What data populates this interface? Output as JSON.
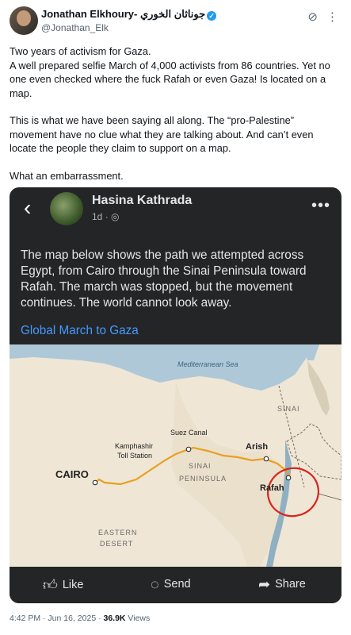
{
  "author": {
    "name": "Jonathan Elkhoury- جوناثان الخوري",
    "handle": "@Jonathan_Elk"
  },
  "tweet": {
    "line1": "Two years of activism for Gaza.",
    "line2": "A well prepared selfie March of 4,000 activists from 86 countries. Yet no one even checked where the fuck Rafah or even Gaza! Is located on a map.",
    "line3": "This is what we have been saying all along. The “pro-Palestine” movement have no clue what they are talking about. And can’t even locate the people they claim to support on a map.",
    "line4": "What an embarrassment."
  },
  "embedded_post": {
    "author": "Hasina Kathrada",
    "age": "1d",
    "text": "The map below shows the path we attempted across Egypt, from Cairo through the Sinai Peninsula toward Rafah. The march was stopped, but the movement continues. The world cannot look away.",
    "link": "Global March to Gaza",
    "map": {
      "sea": "Mediterranean Sea",
      "sinai": "SINAI",
      "suez": "Suez Canal",
      "kamphashir1": "Kamphashir",
      "kamphashir2": "Toll Station",
      "arish": "Arish",
      "cairo": "CAIRO",
      "peninsula1": "SINAI",
      "peninsula2": "PENINSULA",
      "rafah": "Rafah",
      "desert1": "EASTERN",
      "desert2": "DESERT"
    },
    "actions": {
      "like": "Like",
      "send": "Send",
      "share": "Share"
    }
  },
  "footer": {
    "time": "4:42 PM · Jun 16, 2025 · ",
    "views_count": "36.9K",
    "views_label": " Views"
  },
  "colors": {
    "route": "#e8a020",
    "circle": "#d8261e",
    "link": "#4599ff",
    "card_bg": "#242526"
  }
}
